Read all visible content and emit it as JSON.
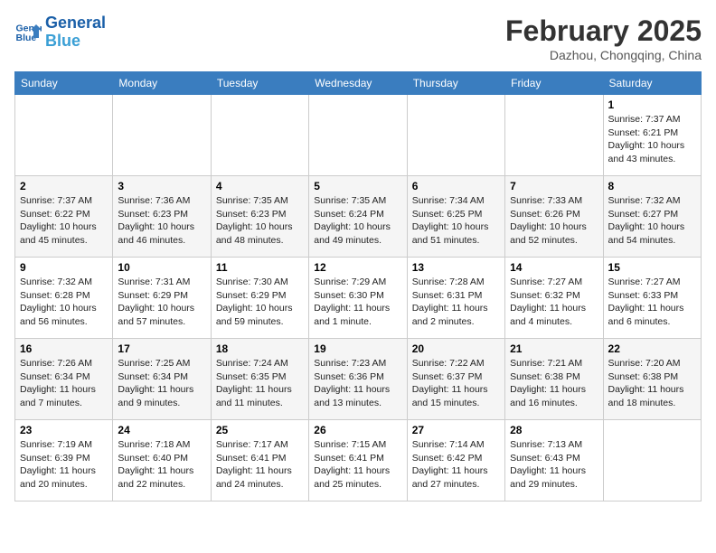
{
  "header": {
    "logo_line1": "General",
    "logo_line2": "Blue",
    "month_title": "February 2025",
    "location": "Dazhou, Chongqing, China"
  },
  "weekdays": [
    "Sunday",
    "Monday",
    "Tuesday",
    "Wednesday",
    "Thursday",
    "Friday",
    "Saturday"
  ],
  "weeks": [
    [
      {
        "day": "",
        "info": ""
      },
      {
        "day": "",
        "info": ""
      },
      {
        "day": "",
        "info": ""
      },
      {
        "day": "",
        "info": ""
      },
      {
        "day": "",
        "info": ""
      },
      {
        "day": "",
        "info": ""
      },
      {
        "day": "1",
        "info": "Sunrise: 7:37 AM\nSunset: 6:21 PM\nDaylight: 10 hours and 43 minutes."
      }
    ],
    [
      {
        "day": "2",
        "info": "Sunrise: 7:37 AM\nSunset: 6:22 PM\nDaylight: 10 hours and 45 minutes."
      },
      {
        "day": "3",
        "info": "Sunrise: 7:36 AM\nSunset: 6:23 PM\nDaylight: 10 hours and 46 minutes."
      },
      {
        "day": "4",
        "info": "Sunrise: 7:35 AM\nSunset: 6:23 PM\nDaylight: 10 hours and 48 minutes."
      },
      {
        "day": "5",
        "info": "Sunrise: 7:35 AM\nSunset: 6:24 PM\nDaylight: 10 hours and 49 minutes."
      },
      {
        "day": "6",
        "info": "Sunrise: 7:34 AM\nSunset: 6:25 PM\nDaylight: 10 hours and 51 minutes."
      },
      {
        "day": "7",
        "info": "Sunrise: 7:33 AM\nSunset: 6:26 PM\nDaylight: 10 hours and 52 minutes."
      },
      {
        "day": "8",
        "info": "Sunrise: 7:32 AM\nSunset: 6:27 PM\nDaylight: 10 hours and 54 minutes."
      }
    ],
    [
      {
        "day": "9",
        "info": "Sunrise: 7:32 AM\nSunset: 6:28 PM\nDaylight: 10 hours and 56 minutes."
      },
      {
        "day": "10",
        "info": "Sunrise: 7:31 AM\nSunset: 6:29 PM\nDaylight: 10 hours and 57 minutes."
      },
      {
        "day": "11",
        "info": "Sunrise: 7:30 AM\nSunset: 6:29 PM\nDaylight: 10 hours and 59 minutes."
      },
      {
        "day": "12",
        "info": "Sunrise: 7:29 AM\nSunset: 6:30 PM\nDaylight: 11 hours and 1 minute."
      },
      {
        "day": "13",
        "info": "Sunrise: 7:28 AM\nSunset: 6:31 PM\nDaylight: 11 hours and 2 minutes."
      },
      {
        "day": "14",
        "info": "Sunrise: 7:27 AM\nSunset: 6:32 PM\nDaylight: 11 hours and 4 minutes."
      },
      {
        "day": "15",
        "info": "Sunrise: 7:27 AM\nSunset: 6:33 PM\nDaylight: 11 hours and 6 minutes."
      }
    ],
    [
      {
        "day": "16",
        "info": "Sunrise: 7:26 AM\nSunset: 6:34 PM\nDaylight: 11 hours and 7 minutes."
      },
      {
        "day": "17",
        "info": "Sunrise: 7:25 AM\nSunset: 6:34 PM\nDaylight: 11 hours and 9 minutes."
      },
      {
        "day": "18",
        "info": "Sunrise: 7:24 AM\nSunset: 6:35 PM\nDaylight: 11 hours and 11 minutes."
      },
      {
        "day": "19",
        "info": "Sunrise: 7:23 AM\nSunset: 6:36 PM\nDaylight: 11 hours and 13 minutes."
      },
      {
        "day": "20",
        "info": "Sunrise: 7:22 AM\nSunset: 6:37 PM\nDaylight: 11 hours and 15 minutes."
      },
      {
        "day": "21",
        "info": "Sunrise: 7:21 AM\nSunset: 6:38 PM\nDaylight: 11 hours and 16 minutes."
      },
      {
        "day": "22",
        "info": "Sunrise: 7:20 AM\nSunset: 6:38 PM\nDaylight: 11 hours and 18 minutes."
      }
    ],
    [
      {
        "day": "23",
        "info": "Sunrise: 7:19 AM\nSunset: 6:39 PM\nDaylight: 11 hours and 20 minutes."
      },
      {
        "day": "24",
        "info": "Sunrise: 7:18 AM\nSunset: 6:40 PM\nDaylight: 11 hours and 22 minutes."
      },
      {
        "day": "25",
        "info": "Sunrise: 7:17 AM\nSunset: 6:41 PM\nDaylight: 11 hours and 24 minutes."
      },
      {
        "day": "26",
        "info": "Sunrise: 7:15 AM\nSunset: 6:41 PM\nDaylight: 11 hours and 25 minutes."
      },
      {
        "day": "27",
        "info": "Sunrise: 7:14 AM\nSunset: 6:42 PM\nDaylight: 11 hours and 27 minutes."
      },
      {
        "day": "28",
        "info": "Sunrise: 7:13 AM\nSunset: 6:43 PM\nDaylight: 11 hours and 29 minutes."
      },
      {
        "day": "",
        "info": ""
      }
    ]
  ]
}
